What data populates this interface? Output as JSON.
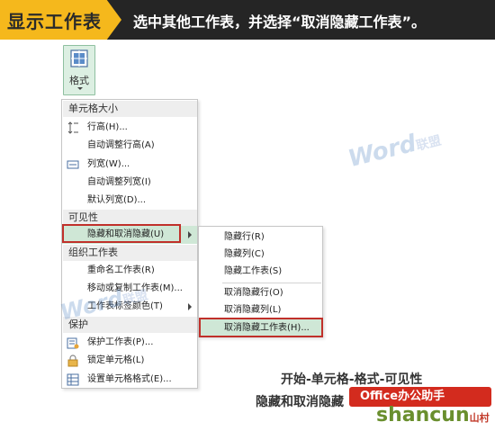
{
  "banner": {
    "tag": "显示工作表",
    "instruction": "选中其他工作表，并选择“取消隐藏工作表”。"
  },
  "ribbon": {
    "format_button_label": "格式"
  },
  "menu": {
    "sections": {
      "cell_size": "单元格大小",
      "visibility": "可见性",
      "organize_sheets": "组织工作表",
      "protection": "保护"
    },
    "items": {
      "row_height": "行高(H)...",
      "autofit_row_height": "自动调整行高(A)",
      "column_width": "列宽(W)...",
      "autofit_column_width": "自动调整列宽(I)",
      "default_width": "默认列宽(D)...",
      "hide_unhide": "隐藏和取消隐藏(U)",
      "rename_sheet": "重命名工作表(R)",
      "move_copy_sheet": "移动或复制工作表(M)...",
      "tab_color": "工作表标签颜色(T)",
      "protect_sheet": "保护工作表(P)...",
      "lock_cell": "锁定单元格(L)",
      "format_cells": "设置单元格格式(E)..."
    }
  },
  "submenu": {
    "items": {
      "hide_rows": "隐藏行(R)",
      "hide_columns": "隐藏列(C)",
      "hide_sheet": "隐藏工作表(S)",
      "unhide_rows": "取消隐藏行(O)",
      "unhide_columns": "取消隐藏列(L)",
      "unhide_sheet": "取消隐藏工作表(H)..."
    }
  },
  "caption": {
    "line1": "开始-单元格-格式-可见性",
    "line2": "隐藏和取消隐藏"
  },
  "watermarks": {
    "word": "Word",
    "cn": "联盟"
  },
  "badge": {
    "top": "Office办公助手",
    "bottom": "shancun",
    "bottom_small": "山村"
  },
  "colors": {
    "accent_yellow": "#f5b81c",
    "highlight_green": "#cfe7d6",
    "highlight_border_red": "#c0302a",
    "badge_red": "#d32b1e"
  }
}
